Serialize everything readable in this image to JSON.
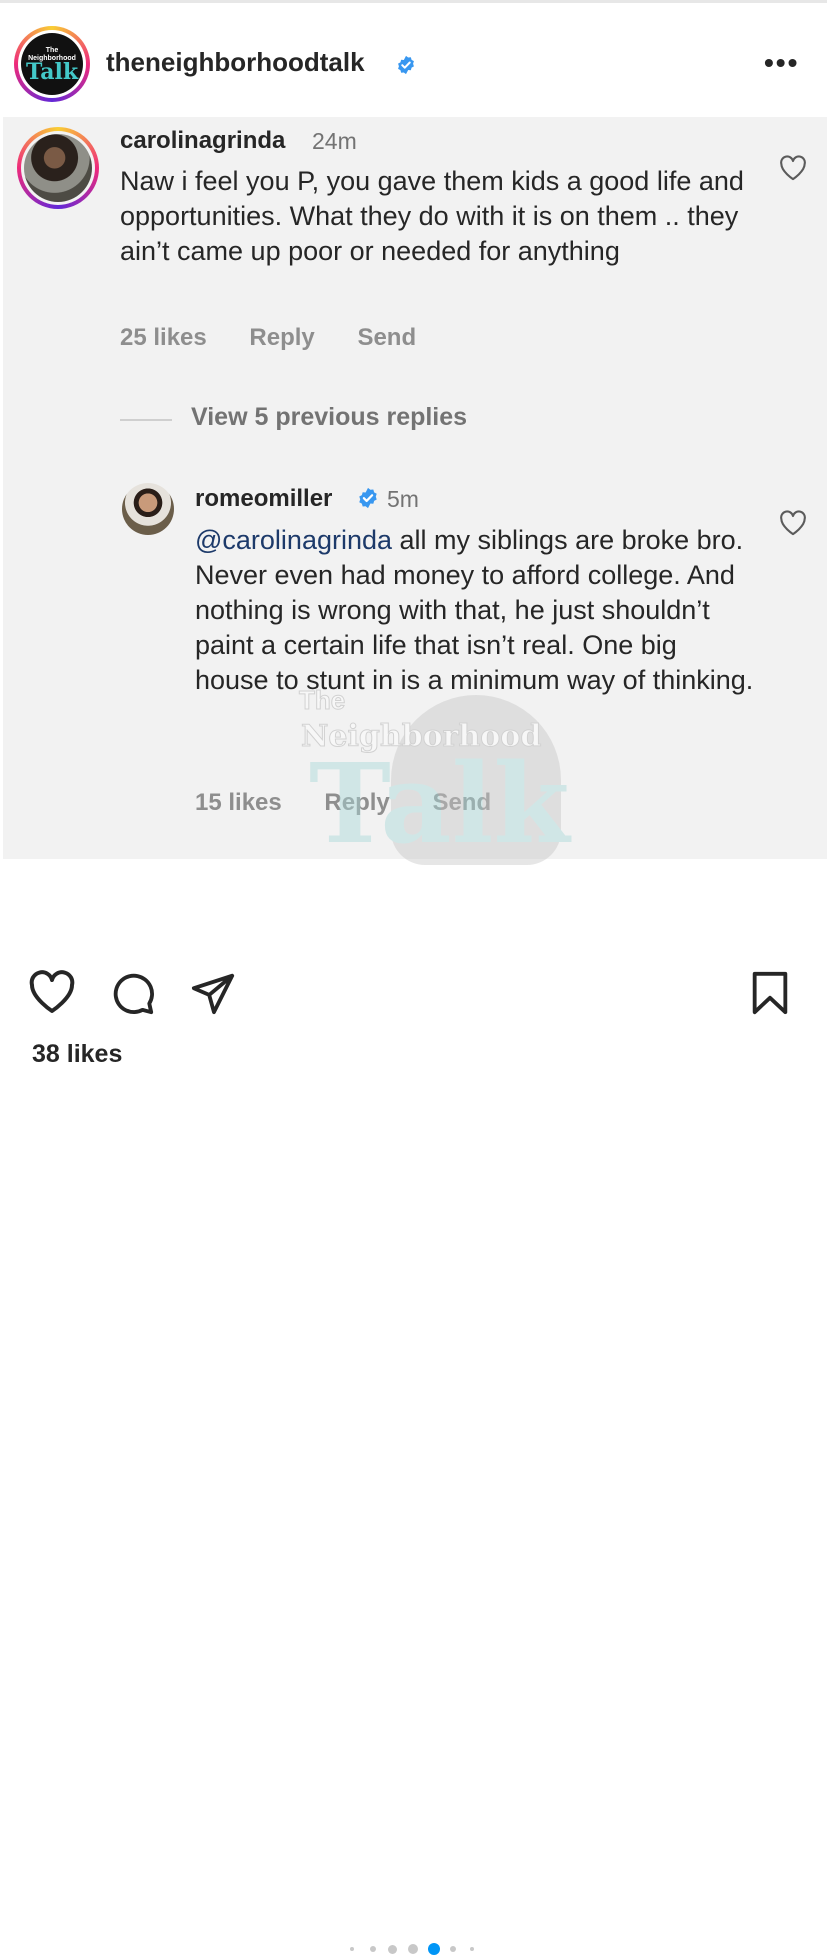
{
  "post": {
    "username": "theneighborhoodtalk",
    "logo_small": "The Neighborhood",
    "logo_big": "Talk",
    "more_label": "•••"
  },
  "comment": {
    "username": "carolinagrinda",
    "time": "24m",
    "text": "Naw i feel you P, you gave them kids a good life and opportunities. What they do with it is on them .. they ain’t came up poor or needed for anything",
    "likes": "25 likes",
    "reply_label": "Reply",
    "send_label": "Send"
  },
  "view_replies": "View 5 previous replies",
  "reply": {
    "username": "romeomiller",
    "time": "5m",
    "mention": "@carolinagrinda",
    "text": " all my siblings are broke bro. Never even had money to afford college. And nothing is wrong with that, he just shouldn’t paint a certain life that isn’t real. One big house to stunt in is a minimum way of thinking.",
    "likes": "15 likes",
    "reply_label": "Reply",
    "send_label": "Send"
  },
  "watermark": {
    "the": "The",
    "neighborhood": "Neighborhood",
    "talk": "Talk"
  },
  "carousel": {
    "total": 7,
    "active_index": 4
  },
  "footer": {
    "likes": "38 likes"
  },
  "colors": {
    "verified": "#3897f0",
    "dot_active": "#0095f6",
    "comment_bg": "#f2f2f2"
  }
}
